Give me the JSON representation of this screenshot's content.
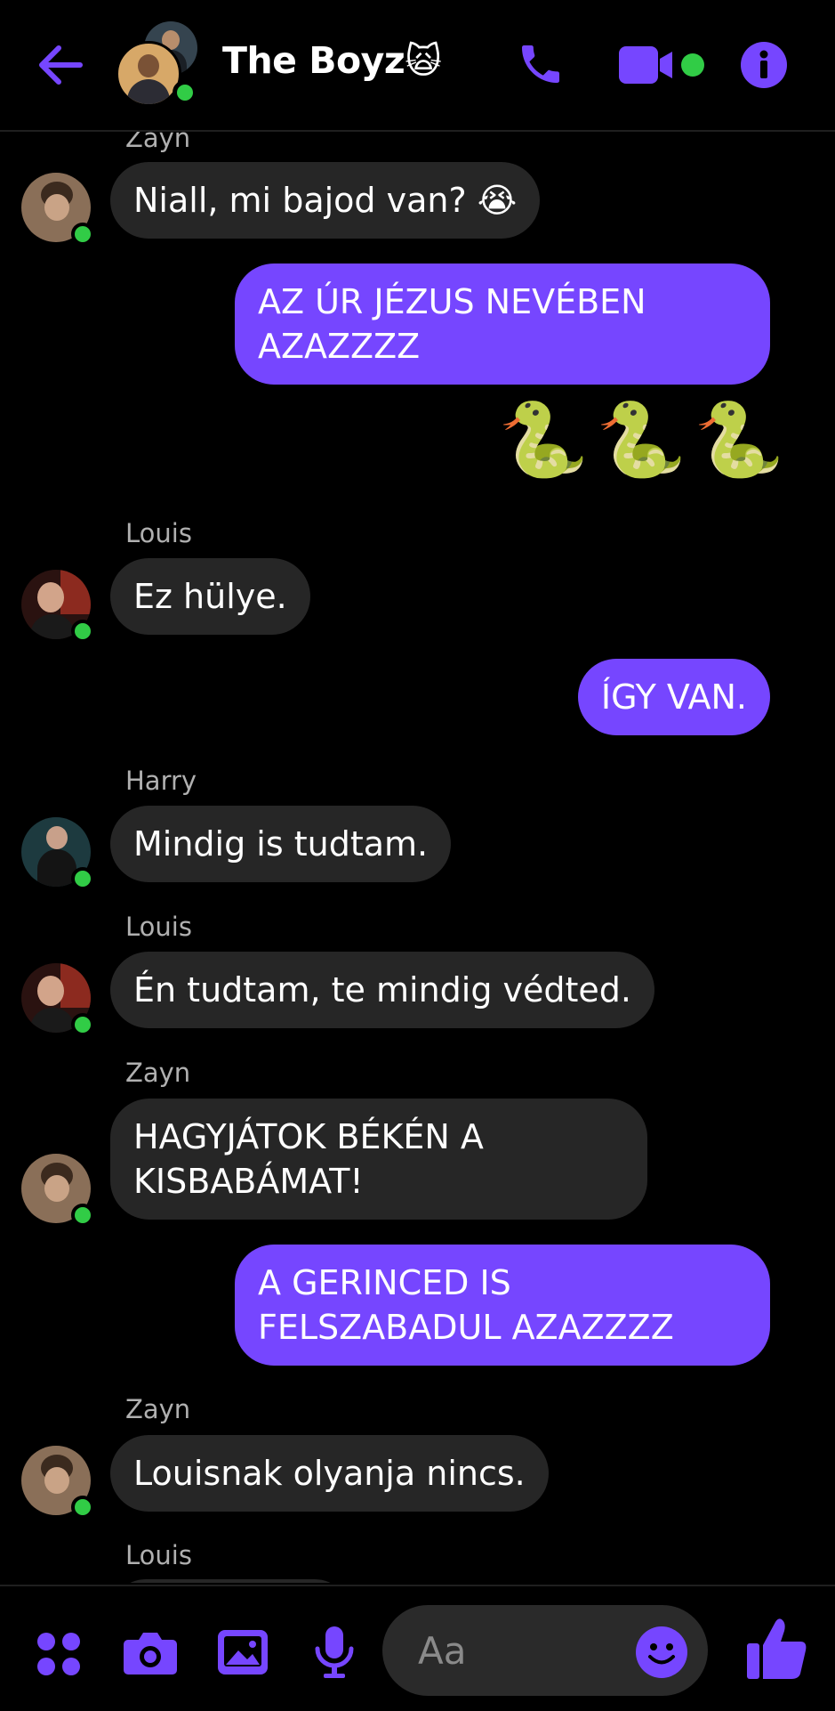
{
  "header": {
    "title": "The Boyz",
    "title_emoji": "🙀",
    "icons": [
      "back-arrow-icon",
      "phone-icon",
      "video-camera-icon",
      "info-icon"
    ]
  },
  "messages": [
    {
      "id": "m1",
      "sender": "Zayn",
      "text": "Niall, mi bajod van? 😭",
      "dir": "in"
    },
    {
      "id": "m2",
      "text": "AZ ÚR JÉZUS NEVÉBEN\nAZAZZZZ",
      "dir": "out"
    },
    {
      "id": "m3",
      "text": "🐍🐍🐍",
      "dir": "out",
      "kind": "emoji"
    },
    {
      "id": "m4",
      "sender": "Louis",
      "text": "Ez hülye.",
      "dir": "in"
    },
    {
      "id": "m5",
      "text": "ÍGY VAN.",
      "dir": "out"
    },
    {
      "id": "m6",
      "sender": "Harry",
      "text": "Mindig is tudtam.",
      "dir": "in"
    },
    {
      "id": "m7",
      "sender": "Louis",
      "text": "Én tudtam, te mindig védted.",
      "dir": "in"
    },
    {
      "id": "m8",
      "sender": "Zayn",
      "text": "HAGYJÁTOK BÉKÉN A\nKISBABÁMAT!",
      "dir": "in"
    },
    {
      "id": "m9",
      "text": "A GERINCED IS\nFELSZABADUL AZAZZZZ",
      "dir": "out"
    },
    {
      "id": "m10",
      "sender": "Zayn",
      "text": "Louisnak olyanja nincs.",
      "dir": "in"
    },
    {
      "id": "m11",
      "sender": "Louis",
      "text": "",
      "dir": "in"
    }
  ],
  "composer": {
    "placeholder": "Aa",
    "icons": [
      "apps-grid-icon",
      "camera-icon",
      "gallery-icon",
      "microphone-icon",
      "emoji-icon",
      "thumbs-up-icon"
    ]
  },
  "colors": {
    "accent": "#7646ff",
    "incoming_bubble": "#262626",
    "online": "#31cc46",
    "background": "#000000"
  }
}
